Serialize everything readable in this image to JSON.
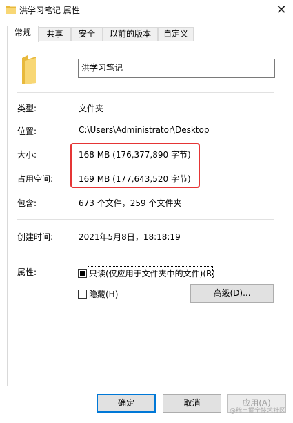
{
  "window": {
    "title": "洪学习笔记 属性",
    "close_glyph": "✕"
  },
  "tabs": [
    {
      "label": "常规",
      "active": true
    },
    {
      "label": "共享"
    },
    {
      "label": "安全"
    },
    {
      "label": "以前的版本"
    },
    {
      "label": "自定义"
    }
  ],
  "general": {
    "name_value": "洪学习笔记",
    "type_label": "类型:",
    "type_value": "文件夹",
    "location_label": "位置:",
    "location_value": "C:\\Users\\Administrator\\Desktop",
    "size_label": "大小:",
    "size_value": "168 MB (176,377,890 字节)",
    "disk_size_label": "占用空间:",
    "disk_size_value": "169 MB (177,643,520 字节)",
    "contains_label": "包含:",
    "contains_value": "673 个文件，259 个文件夹",
    "created_label": "创建时间:",
    "created_value": "2021年5月8日，18:18:19",
    "attributes_label": "属性:",
    "readonly_label": "只读(仅应用于文件夹中的文件)(R)",
    "readonly_state": "checked-indeterminate",
    "hidden_label": "隐藏(H)",
    "hidden_state": "unchecked",
    "advanced_button": "高级(D)..."
  },
  "footer": {
    "ok_button": "确定",
    "cancel_button": "取消",
    "apply_button": "应用(A)"
  },
  "watermark": "@稀土掘金技术社区",
  "colors": {
    "highlight": "#e53535",
    "folder": "#f8d775",
    "default_button_border": "#0078d7"
  },
  "icons": {
    "title_icon": "folder-icon",
    "large_icon": "folder-icon"
  }
}
